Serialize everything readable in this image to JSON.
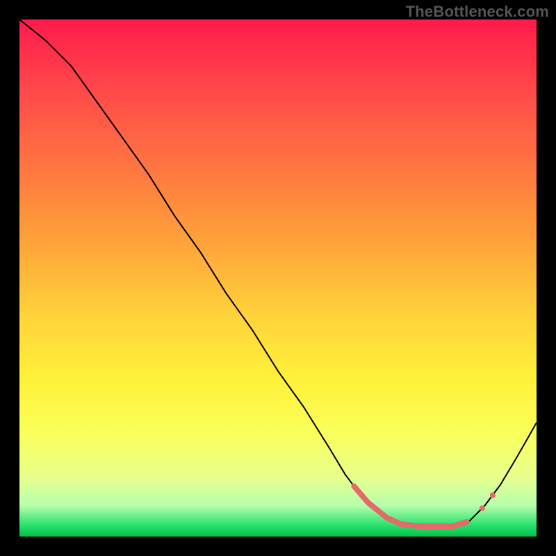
{
  "watermark": "TheBottleneck.com",
  "colors": {
    "background": "#000000",
    "gradient_top": "#ff1a4b",
    "gradient_bottom": "#06c04a",
    "line": "#000000",
    "highlight": "#e46a6a"
  },
  "chart_data": {
    "type": "line",
    "title": "",
    "xlabel": "",
    "ylabel": "",
    "x_range": [
      0,
      100
    ],
    "y_range": [
      0,
      100
    ],
    "grid": false,
    "legend": false,
    "series": [
      {
        "name": "curve",
        "x": [
          0,
          5,
          10,
          15,
          20,
          25,
          30,
          35,
          40,
          45,
          50,
          55,
          60,
          63,
          66,
          69,
          72,
          75,
          78,
          81,
          84,
          87,
          90,
          93,
          96,
          100
        ],
        "y": [
          100,
          96,
          91,
          84,
          77,
          70,
          62,
          55,
          47,
          40,
          32,
          25,
          17,
          12,
          8,
          5,
          3,
          2,
          2,
          2,
          2,
          3,
          6,
          10,
          15,
          22
        ]
      }
    ],
    "highlight_range_x": [
      66,
      88
    ],
    "minimum_x": 78,
    "minimum_y": 2
  }
}
